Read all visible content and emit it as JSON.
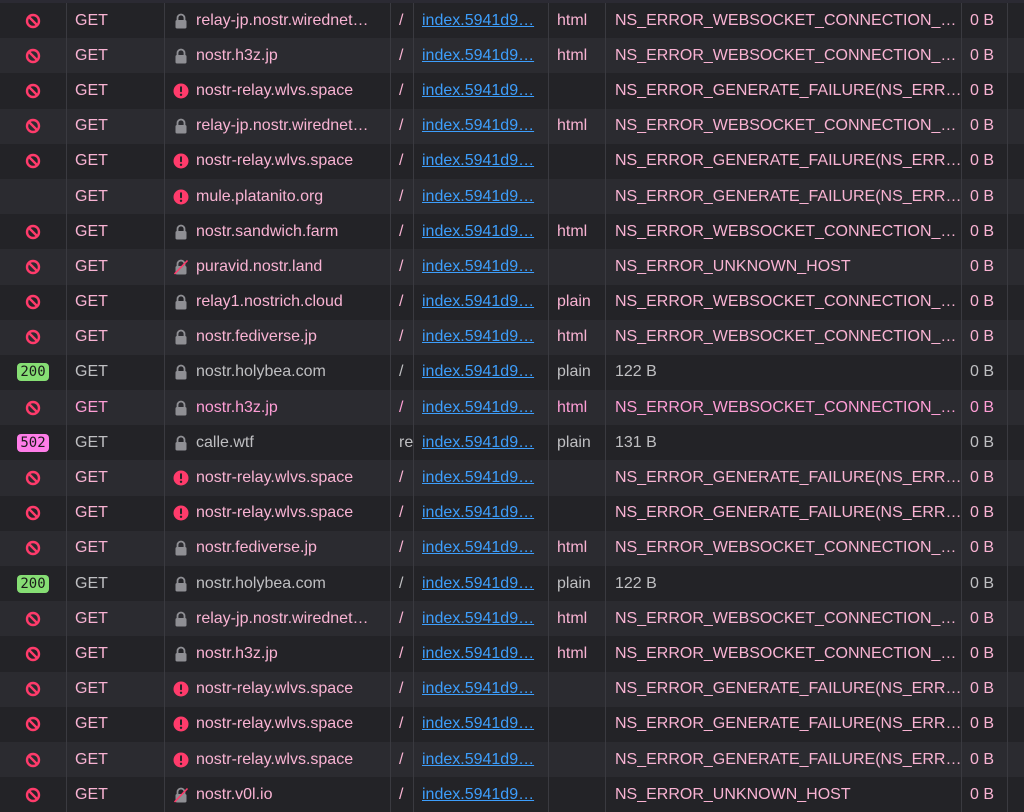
{
  "colors": {
    "blocked": "#ff3b6b",
    "badge_200": "#86de74",
    "badge_502": "#ff7de9",
    "lock": "#8f8f94",
    "link": "#3d9efc"
  },
  "rows": [
    {
      "status": "blocked",
      "method": "GET",
      "security": "lock-icon",
      "domain": "relay-jp.nostr.wirednet…",
      "file": "/",
      "initiator": "index.5941d9…",
      "type": "html",
      "transferred": "NS_ERROR_WEBSOCKET_CONNECTION_…",
      "size": "0 B",
      "state": "err"
    },
    {
      "status": "blocked",
      "method": "GET",
      "security": "lock-icon",
      "domain": "nostr.h3z.jp",
      "file": "/",
      "initiator": "index.5941d9…",
      "type": "html",
      "transferred": "NS_ERROR_WEBSOCKET_CONNECTION_…",
      "size": "0 B",
      "state": "err"
    },
    {
      "status": "blocked",
      "method": "GET",
      "security": "error-icon",
      "domain": "nostr-relay.wlvs.space",
      "file": "/",
      "initiator": "index.5941d9…",
      "type": "",
      "transferred": "NS_ERROR_GENERATE_FAILURE(NS_ERR…",
      "size": "0 B",
      "state": "err"
    },
    {
      "status": "blocked",
      "method": "GET",
      "security": "lock-icon",
      "domain": "relay-jp.nostr.wirednet…",
      "file": "/",
      "initiator": "index.5941d9…",
      "type": "html",
      "transferred": "NS_ERROR_WEBSOCKET_CONNECTION_…",
      "size": "0 B",
      "state": "err"
    },
    {
      "status": "blocked",
      "method": "GET",
      "security": "error-icon",
      "domain": "nostr-relay.wlvs.space",
      "file": "/",
      "initiator": "index.5941d9…",
      "type": "",
      "transferred": "NS_ERROR_GENERATE_FAILURE(NS_ERR…",
      "size": "0 B",
      "state": "err"
    },
    {
      "status": "",
      "method": "GET",
      "security": "error-icon",
      "domain": "mule.platanito.org",
      "file": "/",
      "initiator": "index.5941d9…",
      "type": "",
      "transferred": "NS_ERROR_GENERATE_FAILURE(NS_ERR…",
      "size": "0 B",
      "state": "err"
    },
    {
      "status": "blocked",
      "method": "GET",
      "security": "lock-icon",
      "domain": "nostr.sandwich.farm",
      "file": "/",
      "initiator": "index.5941d9…",
      "type": "html",
      "transferred": "NS_ERROR_WEBSOCKET_CONNECTION_…",
      "size": "0 B",
      "state": "err"
    },
    {
      "status": "blocked",
      "method": "GET",
      "security": "insecure-lock-icon",
      "domain": "puravid.nostr.land",
      "file": "/",
      "initiator": "index.5941d9…",
      "type": "",
      "transferred": "NS_ERROR_UNKNOWN_HOST",
      "size": "0 B",
      "state": "err"
    },
    {
      "status": "blocked",
      "method": "GET",
      "security": "lock-icon",
      "domain": "relay1.nostrich.cloud",
      "file": "/",
      "initiator": "index.5941d9…",
      "type": "plain",
      "transferred": "NS_ERROR_WEBSOCKET_CONNECTION_…",
      "size": "0 B",
      "state": "err"
    },
    {
      "status": "blocked",
      "method": "GET",
      "security": "lock-icon",
      "domain": "nostr.fediverse.jp",
      "file": "/",
      "initiator": "index.5941d9…",
      "type": "html",
      "transferred": "NS_ERROR_WEBSOCKET_CONNECTION_…",
      "size": "0 B",
      "state": "err"
    },
    {
      "status": "200",
      "method": "GET",
      "security": "lock-icon",
      "domain": "nostr.holybea.com",
      "file": "/",
      "initiator": "index.5941d9…",
      "type": "plain",
      "transferred": "122 B",
      "size": "0 B",
      "state": "ok"
    },
    {
      "status": "blocked",
      "method": "GET",
      "security": "lock-icon",
      "domain": "nostr.h3z.jp",
      "file": "/",
      "initiator": "index.5941d9…",
      "type": "html",
      "transferred": "NS_ERROR_WEBSOCKET_CONNECTION_…",
      "size": "0 B",
      "state": "sel"
    },
    {
      "status": "502",
      "method": "GET",
      "security": "lock-icon",
      "domain": "calle.wtf",
      "file": "re",
      "initiator": "index.5941d9…",
      "type": "plain",
      "transferred": "131 B",
      "size": "0 B",
      "state": "ok"
    },
    {
      "status": "blocked",
      "method": "GET",
      "security": "error-icon",
      "domain": "nostr-relay.wlvs.space",
      "file": "/",
      "initiator": "index.5941d9…",
      "type": "",
      "transferred": "NS_ERROR_GENERATE_FAILURE(NS_ERR…",
      "size": "0 B",
      "state": "err"
    },
    {
      "status": "blocked",
      "method": "GET",
      "security": "error-icon",
      "domain": "nostr-relay.wlvs.space",
      "file": "/",
      "initiator": "index.5941d9…",
      "type": "",
      "transferred": "NS_ERROR_GENERATE_FAILURE(NS_ERR…",
      "size": "0 B",
      "state": "err"
    },
    {
      "status": "blocked",
      "method": "GET",
      "security": "lock-icon",
      "domain": "nostr.fediverse.jp",
      "file": "/",
      "initiator": "index.5941d9…",
      "type": "html",
      "transferred": "NS_ERROR_WEBSOCKET_CONNECTION_…",
      "size": "0 B",
      "state": "err"
    },
    {
      "status": "200",
      "method": "GET",
      "security": "lock-icon",
      "domain": "nostr.holybea.com",
      "file": "/",
      "initiator": "index.5941d9…",
      "type": "plain",
      "transferred": "122 B",
      "size": "0 B",
      "state": "ok"
    },
    {
      "status": "blocked",
      "method": "GET",
      "security": "lock-icon",
      "domain": "relay-jp.nostr.wirednet…",
      "file": "/",
      "initiator": "index.5941d9…",
      "type": "html",
      "transferred": "NS_ERROR_WEBSOCKET_CONNECTION_…",
      "size": "0 B",
      "state": "err"
    },
    {
      "status": "blocked",
      "method": "GET",
      "security": "lock-icon",
      "domain": "nostr.h3z.jp",
      "file": "/",
      "initiator": "index.5941d9…",
      "type": "html",
      "transferred": "NS_ERROR_WEBSOCKET_CONNECTION_…",
      "size": "0 B",
      "state": "err"
    },
    {
      "status": "blocked",
      "method": "GET",
      "security": "error-icon",
      "domain": "nostr-relay.wlvs.space",
      "file": "/",
      "initiator": "index.5941d9…",
      "type": "",
      "transferred": "NS_ERROR_GENERATE_FAILURE(NS_ERR…",
      "size": "0 B",
      "state": "err"
    },
    {
      "status": "blocked",
      "method": "GET",
      "security": "error-icon",
      "domain": "nostr-relay.wlvs.space",
      "file": "/",
      "initiator": "index.5941d9…",
      "type": "",
      "transferred": "NS_ERROR_GENERATE_FAILURE(NS_ERR…",
      "size": "0 B",
      "state": "err"
    },
    {
      "status": "blocked",
      "method": "GET",
      "security": "error-icon",
      "domain": "nostr-relay.wlvs.space",
      "file": "/",
      "initiator": "index.5941d9…",
      "type": "",
      "transferred": "NS_ERROR_GENERATE_FAILURE(NS_ERR…",
      "size": "0 B",
      "state": "err"
    },
    {
      "status": "blocked",
      "method": "GET",
      "security": "insecure-lock-icon",
      "domain": "nostr.v0l.io",
      "file": "/",
      "initiator": "index.5941d9…",
      "type": "",
      "transferred": "NS_ERROR_UNKNOWN_HOST",
      "size": "0 B",
      "state": "err"
    }
  ]
}
